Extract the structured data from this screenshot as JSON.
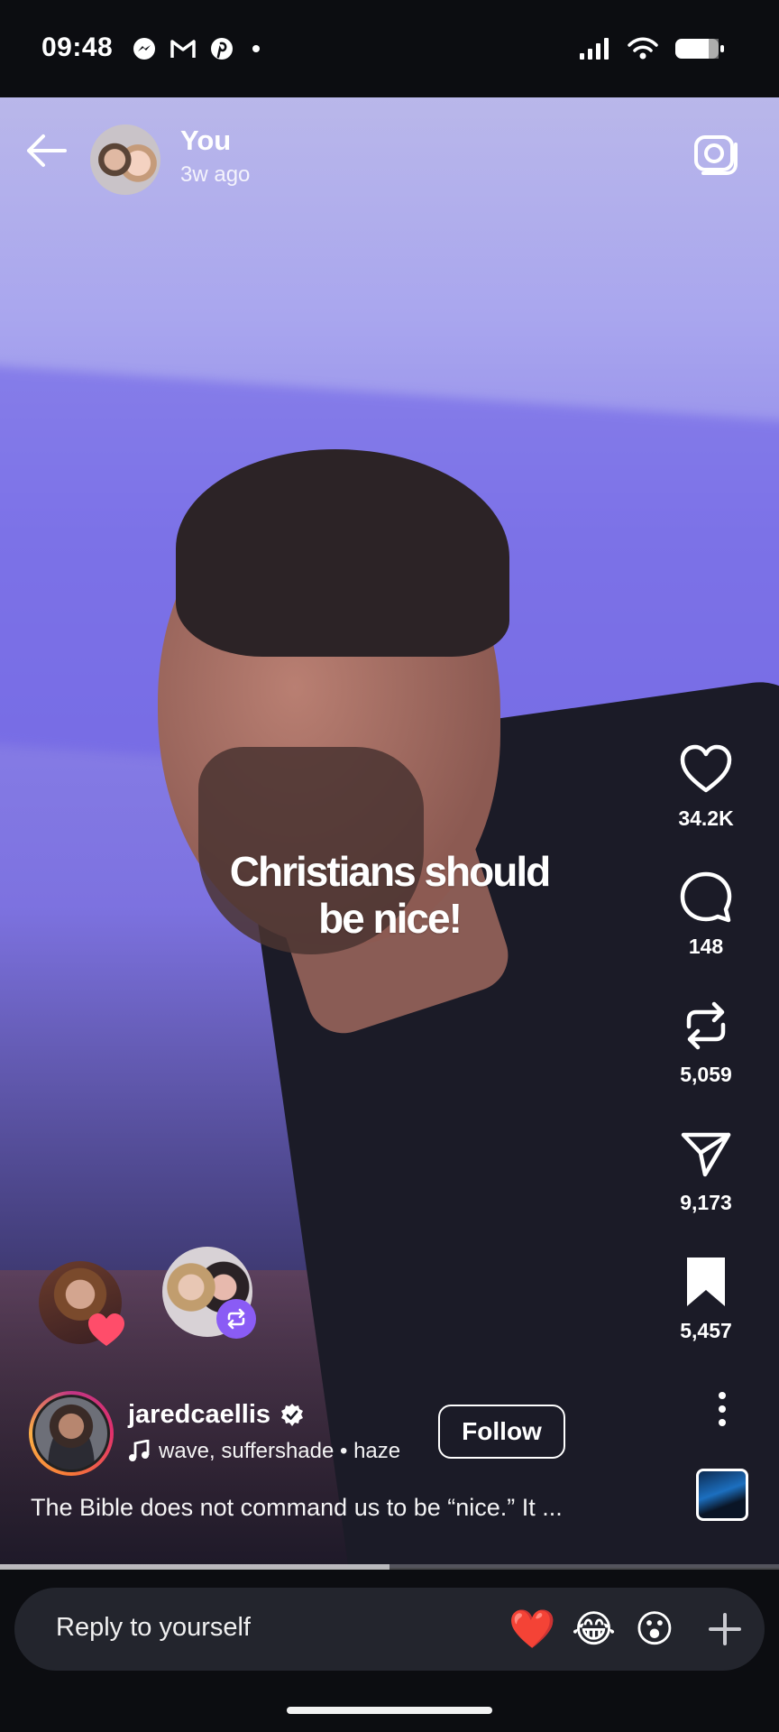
{
  "status_bar": {
    "time": "09:48",
    "left_icons": [
      "messenger-icon",
      "gmail-icon",
      "pinterest-icon",
      "dot-icon"
    ],
    "right_icons": [
      "signal-icon",
      "wifi-icon",
      "battery-icon"
    ]
  },
  "header": {
    "owner_name": "You",
    "posted_time": "3w ago"
  },
  "video": {
    "caption_line1": "Christians should",
    "caption_line2": "be nice!",
    "progress": 0.5
  },
  "actions": {
    "likes": "34.2K",
    "comments": "148",
    "reposts": "5,059",
    "shares": "9,173",
    "saves": "5,457"
  },
  "creator": {
    "username": "jaredcaellis",
    "verified": true,
    "audio": "wave, suffershade • haze",
    "follow_label": "Follow",
    "description": "The Bible does not command us to be “nice.” It ..."
  },
  "reply": {
    "placeholder": "Reply to yourself",
    "quick_reactions": [
      "❤️",
      "😂",
      "😮"
    ]
  },
  "colors": {
    "background": "#0c0d11",
    "video_purple": "#7d72e0",
    "repost_badge": "#8a5cf5",
    "heart_badge": "#ff4d6a"
  }
}
